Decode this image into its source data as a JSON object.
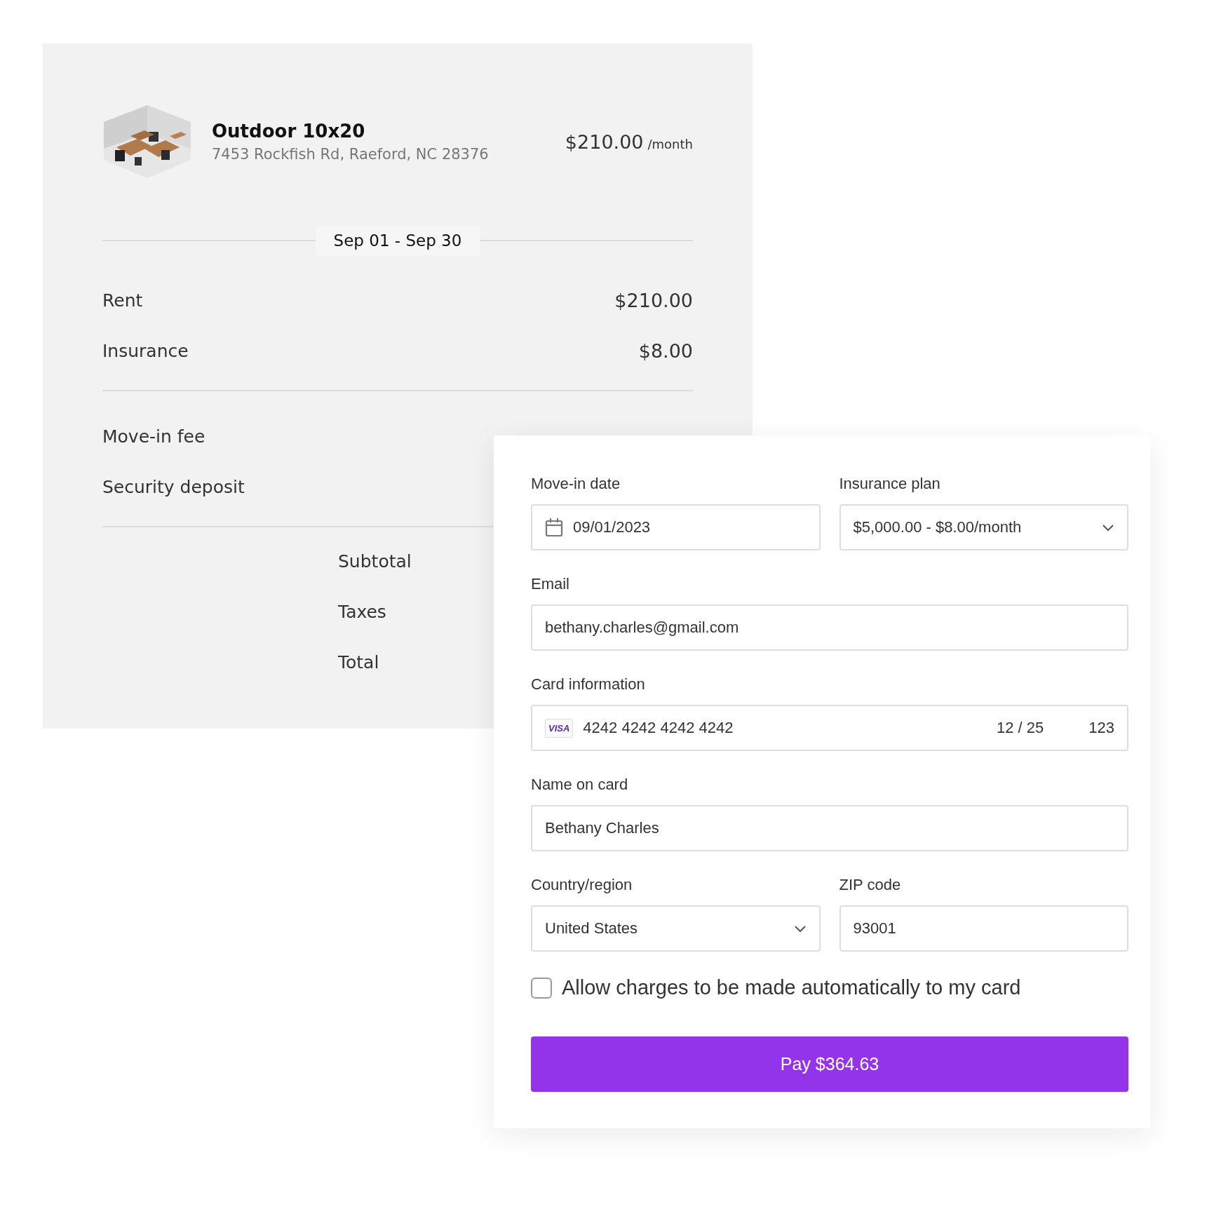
{
  "unit": {
    "kind": "picture",
    "title": "Outdoor 10x20",
    "address": "7453 Rockfish Rd, Raeford, NC 28376",
    "price": "$210.00",
    "price_unit": "/month"
  },
  "period": "Sep 01 - Sep 30",
  "charges": [
    {
      "label": "Rent",
      "amount": "$210.00"
    },
    {
      "label": "Insurance",
      "amount": "$8.00"
    }
  ],
  "fees": [
    {
      "label": "Move-in fee"
    },
    {
      "label": "Security deposit"
    }
  ],
  "summary": [
    {
      "label": "Subtotal"
    },
    {
      "label": "Taxes"
    },
    {
      "label": "Total"
    }
  ],
  "form": {
    "move_in_date": {
      "label": "Move-in date",
      "value": "09/01/2023"
    },
    "insurance_plan": {
      "label": "Insurance plan",
      "value": "$5,000.00 - $8.00/month"
    },
    "email": {
      "label": "Email",
      "value": "bethany.charles@gmail.com"
    },
    "card": {
      "label": "Card information",
      "brand": "VISA",
      "number": "4242 4242 4242 4242",
      "expiry": "12 / 25",
      "cvc": "123"
    },
    "name_on_card": {
      "label": "Name on card",
      "value": "Bethany Charles"
    },
    "country": {
      "label": "Country/region",
      "value": "United States"
    },
    "zip": {
      "label": "ZIP code",
      "value": "93001"
    },
    "autopay": {
      "label": "Allow charges to be made automatically to my card",
      "checked": false
    },
    "pay_button": "Pay $364.63"
  }
}
